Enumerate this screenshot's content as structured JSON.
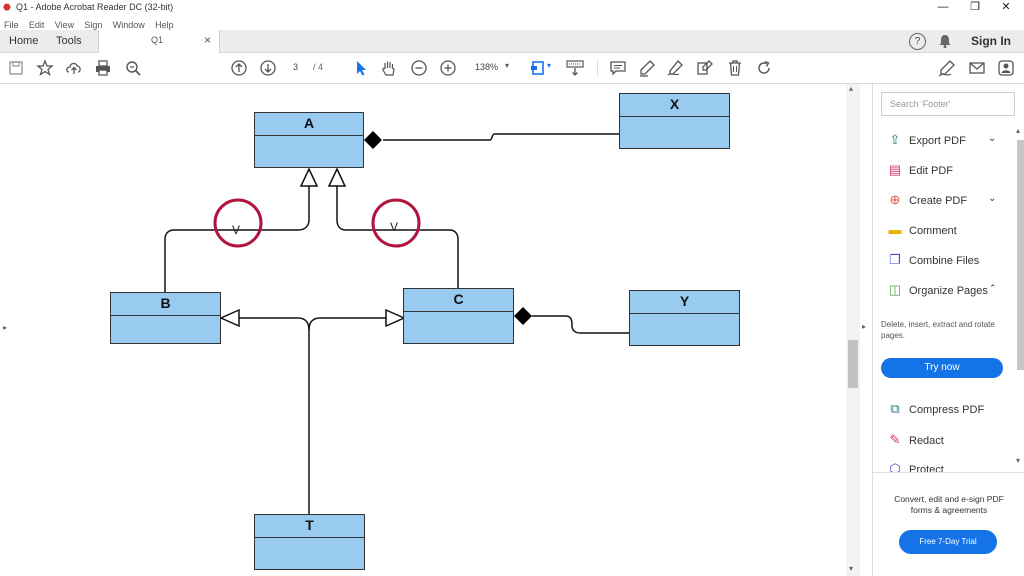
{
  "window": {
    "title": "Q1 - Adobe Acrobat Reader DC (32-bit)",
    "minimize": "—",
    "maximize": "❐",
    "close": "✕"
  },
  "menu": [
    "File",
    "Edit",
    "View",
    "Sign",
    "Window",
    "Help"
  ],
  "tabs": {
    "home": "Home",
    "tools": "Tools",
    "doc": "Q1",
    "doc_close": "×"
  },
  "header": {
    "help": "?",
    "sign_in": "Sign In"
  },
  "toolbar": {
    "page_current": "3",
    "page_total": "/ 4",
    "zoom": "138%"
  },
  "diagram": {
    "boxes": {
      "a": "A",
      "x": "X",
      "b": "B",
      "c": "C",
      "y": "Y",
      "t": "T"
    },
    "circle_left": "V",
    "circle_right": "V"
  },
  "panel": {
    "search_placeholder": "Search 'Footer'",
    "items": [
      {
        "label": "Export PDF",
        "icon": "export-pdf-icon",
        "color": "#2e7d8c"
      },
      {
        "label": "Edit PDF",
        "icon": "edit-pdf-icon",
        "color": "#d6336c"
      },
      {
        "label": "Create PDF",
        "icon": "create-pdf-icon",
        "color": "#d9534f"
      },
      {
        "label": "Comment",
        "icon": "comment-icon",
        "color": "#e8b400"
      },
      {
        "label": "Combine Files",
        "icon": "combine-files-icon",
        "color": "#3a4fd0"
      },
      {
        "label": "Organize Pages",
        "icon": "organize-pages-icon",
        "color": "#4caf50"
      }
    ],
    "organize_desc": "Delete, insert, extract and rotate pages.",
    "try_now": "Try now",
    "items2": [
      {
        "label": "Compress PDF",
        "icon": "compress-pdf-icon",
        "color": "#2e7d8c"
      },
      {
        "label": "Redact",
        "icon": "redact-icon",
        "color": "#d6336c"
      },
      {
        "label": "Protect",
        "icon": "protect-icon",
        "color": "#4a4fc0"
      }
    ],
    "promo_text": "Convert, edit and e-sign PDF forms & agreements",
    "trial_button": "Free 7-Day Trial"
  },
  "colors": {
    "accent": "#1473e6",
    "box_fill": "#99cbf0",
    "circle": "#b0153e"
  }
}
